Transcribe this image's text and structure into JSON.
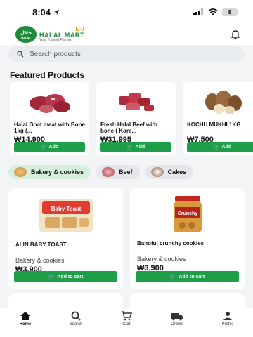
{
  "status": {
    "time": "8:04",
    "battery": "8"
  },
  "header": {
    "logo_arabic": "حلال",
    "logo_halal_caption": "HALAL",
    "logo_badge": "E-9",
    "logo_name": "HALAL MART",
    "logo_tagline": "Your Trusted Partner"
  },
  "search": {
    "placeholder": "Search products"
  },
  "featured": {
    "title": "Featured Products",
    "items": [
      {
        "name": "Halal Goat meat with Bone 1kg (...",
        "price": "₩14,900",
        "add_label": "Add"
      },
      {
        "name": "Fresh Halal Beef with bone ( Kore...",
        "price": "₩31,995",
        "add_label": "Add"
      },
      {
        "name": "KOCHU MUKHI 1KG",
        "price": "₩7,500",
        "add_label": "Add"
      }
    ]
  },
  "categories": [
    {
      "label": "Bakery & cookies",
      "active": true
    },
    {
      "label": "Beef",
      "active": false
    },
    {
      "label": "Cakes",
      "active": false
    }
  ],
  "products": [
    {
      "name": "ALIN BABY TOAST",
      "category": "Bakery & cookies",
      "price": "₩3,900",
      "cart_label": "Add to cart",
      "package_text": "Baby Toast"
    },
    {
      "name": "Banoful crunchy cookies",
      "category": "Bakery & cookies",
      "price": "₩3,900",
      "cart_label": "Add to cart",
      "package_text": "Crunchy"
    }
  ],
  "nav": [
    {
      "label": "Home",
      "icon": "home-icon"
    },
    {
      "label": "Search",
      "icon": "search-icon"
    },
    {
      "label": "Cart",
      "icon": "cart-icon"
    },
    {
      "label": "Orders",
      "icon": "orders-icon"
    },
    {
      "label": "Profile",
      "icon": "profile-icon"
    }
  ]
}
